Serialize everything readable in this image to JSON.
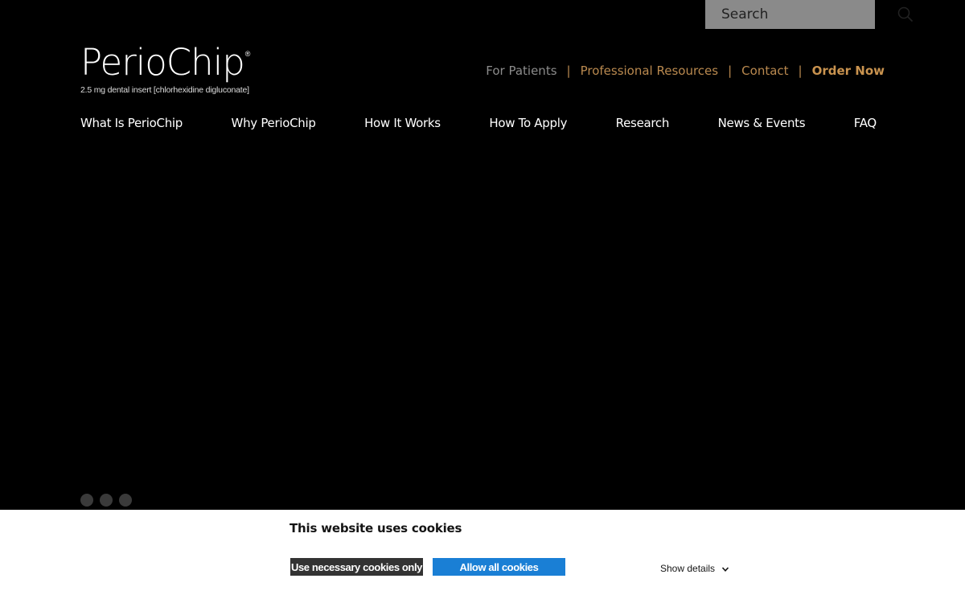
{
  "search": {
    "placeholder": "Search"
  },
  "logo": {
    "wordmark": "PerioChip",
    "registered": "®",
    "tagline": "2.5 mg dental insert [chlorhexidine digluconate]"
  },
  "utility_nav": {
    "for_patients": "For Patients",
    "separator": "|",
    "professional_resources": "Professional Resources",
    "contact": "Contact",
    "order_now": "Order Now"
  },
  "main_nav": {
    "items": [
      {
        "label": "What Is PerioChip"
      },
      {
        "label": "Why PerioChip"
      },
      {
        "label": "How It Works"
      },
      {
        "label": "How To Apply"
      },
      {
        "label": "Research"
      },
      {
        "label": "News & Events"
      },
      {
        "label": "FAQ"
      }
    ]
  },
  "carousel": {
    "slide_count": 3
  },
  "cookie_banner": {
    "title": "This website uses cookies",
    "necessary_label": "Use necessary cookies only",
    "allow_label": "Allow all cookies",
    "details_label": "Show details"
  },
  "colors": {
    "background": "#000000",
    "accent_gold": "#b9894f",
    "muted_gray": "#8c8c8c",
    "allow_blue": "#1a7fd5"
  },
  "icons": {
    "search": "search-icon",
    "chevron": "chevron-down-icon"
  }
}
